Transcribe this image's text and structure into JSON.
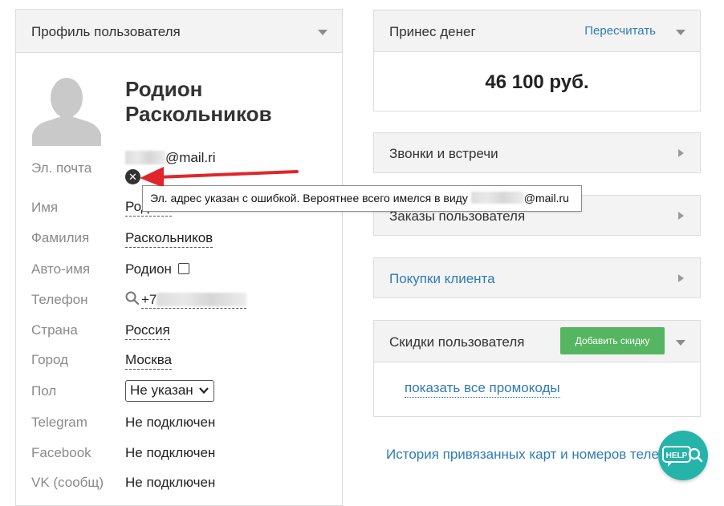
{
  "profile": {
    "title": "Профиль пользователя",
    "first_name_line": "Родион",
    "last_name_line": "Раскольников",
    "email": {
      "label": "Эл. почта",
      "value_suffix": "@mail.ri",
      "error_icon": "close-circle-icon"
    },
    "fields": {
      "first_name": {
        "label": "Имя",
        "value": "Родион"
      },
      "last_name": {
        "label": "Фамилия",
        "value": "Раскольников"
      },
      "auto_name": {
        "label": "Авто-имя",
        "value": "Родион"
      },
      "phone": {
        "label": "Телефон",
        "value_prefix": "+7"
      },
      "country": {
        "label": "Страна",
        "value": "Россия"
      },
      "city": {
        "label": "Город",
        "value": "Москва"
      },
      "gender": {
        "label": "Пол",
        "value": "Не указан"
      },
      "telegram": {
        "label": "Telegram",
        "value": "Не подключен"
      },
      "facebook": {
        "label": "Facebook",
        "value": "Не подключен"
      },
      "vk": {
        "label": "VK (сообщ)",
        "value": "Не подключен"
      }
    }
  },
  "tooltip": {
    "text": "Эл. адрес указан с ошибкой. Вероятнее всего имелся в виду",
    "suggestion_suffix": "@mail.ru"
  },
  "money": {
    "title": "Принес денег",
    "recalc_label": "Пересчитать",
    "amount": "46 100 руб."
  },
  "sections": {
    "calls": "Звонки и встречи",
    "orders": "Заказы пользователя",
    "purchases": "Покупки клиента"
  },
  "discounts": {
    "title": "Скидки пользователя",
    "add_button": "Добавить скидку",
    "show_promocodes": "показать все промокоды"
  },
  "history_link": "История привязанных карт и номеров телефонов",
  "help_button": "HELP",
  "colors": {
    "link": "#2e7bb8",
    "green_button": "#55b560",
    "help_button": "#25b4aa",
    "arrow": "#e0262b",
    "panel_header": "#f3f3f3"
  }
}
